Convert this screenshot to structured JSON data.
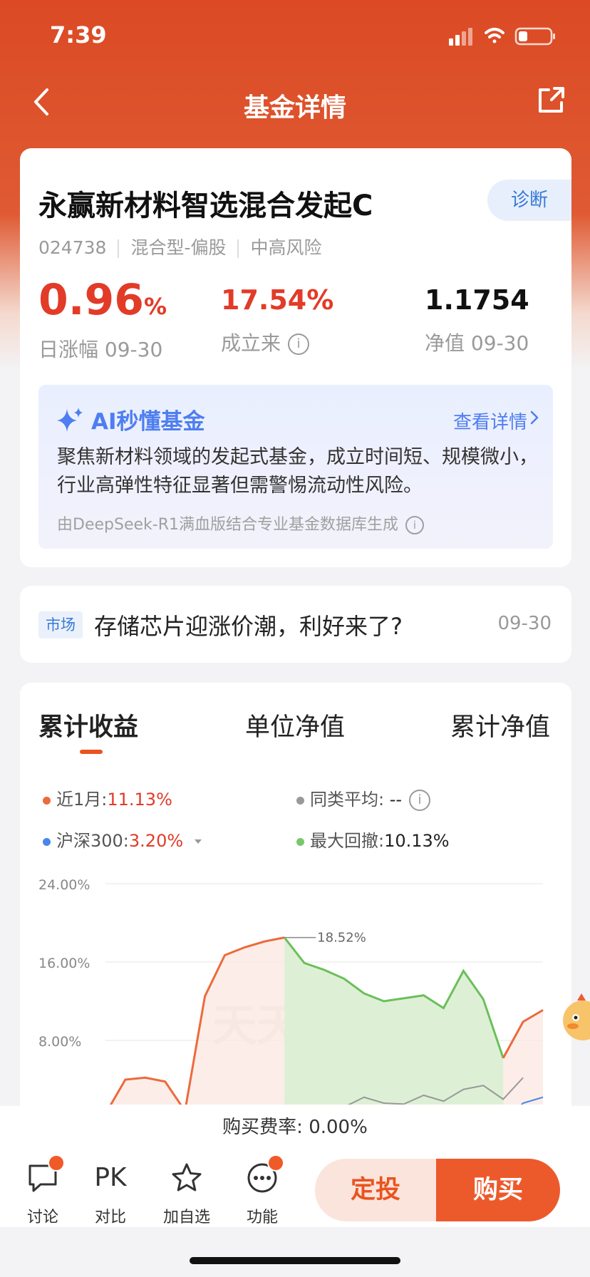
{
  "status": {
    "time": "7:39"
  },
  "nav": {
    "title": "基金详情"
  },
  "fund": {
    "name": "永赢新材料智选混合发起C",
    "diagnose_label": "诊断",
    "code": "024738",
    "type": "混合型-偏股",
    "risk": "中高风险",
    "daily_change_value": "0.96",
    "daily_change_unit": "%",
    "daily_change_label": "日涨幅 09-30",
    "since_inception_value": "17.54%",
    "since_inception_label": "成立来",
    "nav_value": "1.1754",
    "nav_label": "净值 09-30"
  },
  "ai": {
    "title": "AI秒懂基金",
    "more": "查看详情",
    "summary": "聚焦新材料领域的发起式基金，成立时间短、规模微小，行业高弹性特征显著但需警惕流动性风险。",
    "footer": "由DeepSeek-R1满血版结合专业基金数据库生成"
  },
  "news": {
    "tag": "市场",
    "title": "存储芯片迎涨价潮，利好来了?",
    "date": "09-30"
  },
  "chart_tabs": [
    "累计收益",
    "单位净值",
    "累计净值"
  ],
  "legend": {
    "recent_label": "近1月:",
    "recent_value": "11.13%",
    "peer_label": "同类平均:",
    "peer_value": "--",
    "index_label": "沪深300:",
    "index_value": "3.20%",
    "drawdown_label": "最大回撤:",
    "drawdown_value": "10.13%"
  },
  "chart_data": {
    "type": "line",
    "ylim": [
      0,
      24
    ],
    "yticks": [
      "24.00%",
      "16.00%",
      "8.00%"
    ],
    "watermark": "天天基金",
    "peak_label": "18.52%",
    "series": [
      {
        "name": "近1月",
        "color": "#ec6a3c",
        "values": [
          0.5,
          4.0,
          4.2,
          3.8,
          0.8,
          12.5,
          16.7,
          17.5,
          18.1,
          18.5,
          15.9,
          15.2,
          14.3,
          12.8,
          12.0,
          12.3,
          12.6,
          11.3,
          15.1,
          12.2,
          6.2,
          9.9,
          11.1
        ]
      },
      {
        "name": "同类平均",
        "color": "#999999",
        "values": [
          null,
          null,
          null,
          null,
          null,
          null,
          null,
          null,
          null,
          0.6,
          0.8,
          0.8,
          1.2,
          2.2,
          1.6,
          1.5,
          2.4,
          1.8,
          3.0,
          3.4,
          2.0,
          4.2,
          null
        ]
      },
      {
        "name": "沪深300",
        "color": "#4a86e8",
        "values": [
          null,
          null,
          null,
          null,
          null,
          null,
          null,
          null,
          null,
          null,
          null,
          null,
          null,
          null,
          null,
          null,
          null,
          null,
          -0.2,
          0.6,
          -0.5,
          1.6,
          2.2
        ]
      }
    ]
  },
  "fee": {
    "label": "购买费率:",
    "value": "0.00%"
  },
  "bottom": {
    "discuss": "讨论",
    "pk_icon": "PK",
    "compare": "对比",
    "watchlist": "加自选",
    "functions": "功能",
    "dingtou": "定投",
    "buy": "购买"
  }
}
